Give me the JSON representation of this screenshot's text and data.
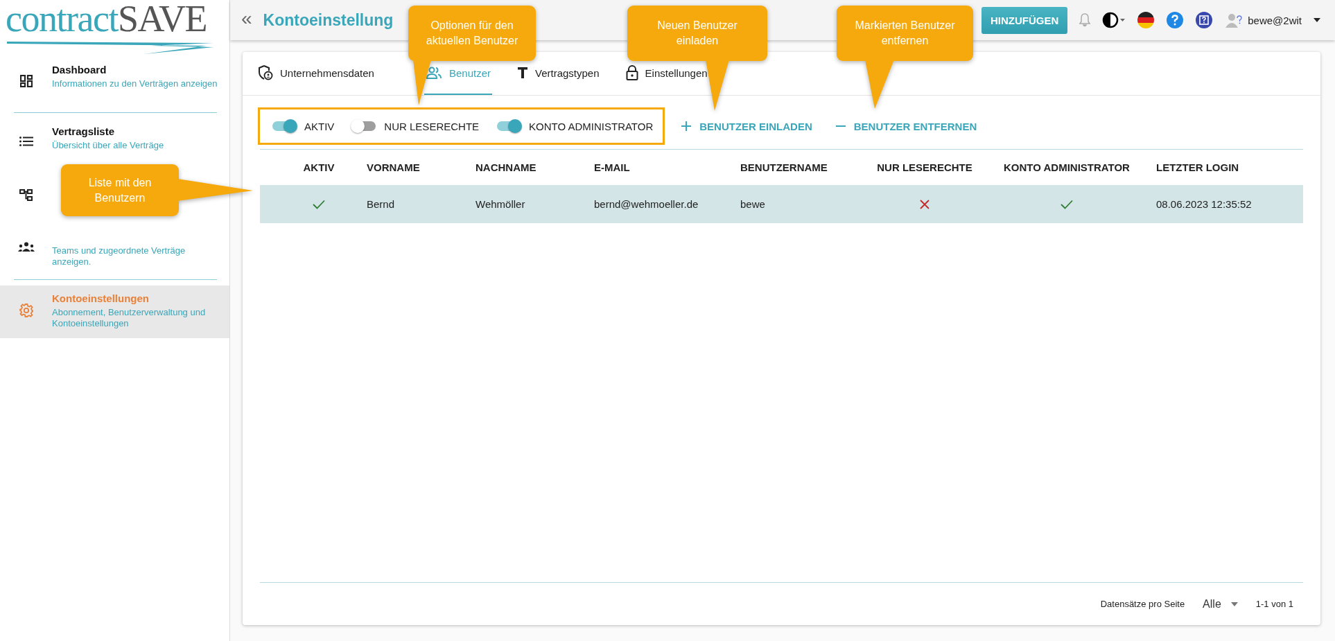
{
  "logo": {
    "left": "contract",
    "right": "SAVE"
  },
  "sidebar": {
    "items": [
      {
        "kind": "dashboard",
        "title": "Dashboard",
        "subtitle": "Informationen zu den Verträgen anzeigen",
        "selected": false,
        "divider": true
      },
      {
        "kind": "list",
        "title": "Vertragsliste",
        "subtitle": "Übersicht über alle Verträge",
        "selected": false,
        "divider": false
      },
      {
        "kind": "hierarchy",
        "selected": false,
        "divider": false
      },
      {
        "kind": "teams",
        "subtitle": "Teams und zugeordnete Verträge anzeigen.",
        "selected": false,
        "divider": true
      },
      {
        "kind": "gear",
        "title": "Kontoeinstellungen",
        "subtitle": "Abonnement, Benutzerverwaltung und Kontoeinstellungen",
        "selected": true,
        "divider": false
      }
    ]
  },
  "topbar": {
    "collapse": "«",
    "title": "Kontoeinstellung",
    "button": "HINZUFÜGEN",
    "user": "bewe@2wit"
  },
  "tabs": [
    {
      "kind": "company",
      "label": "Unternehmensdaten",
      "selected": false
    },
    {
      "kind": "users",
      "label": "Benutzer",
      "selected": true
    },
    {
      "kind": "text",
      "label": "Vertragstypen",
      "selected": false
    },
    {
      "kind": "lock",
      "label": "Einstellungen",
      "selected": false
    }
  ],
  "toggles": [
    {
      "label": "AKTIV",
      "on": true
    },
    {
      "label": "NUR LESERECHTE",
      "on": false
    },
    {
      "label": "KONTO ADMINISTRATOR",
      "on": true
    }
  ],
  "actions": [
    {
      "kind": "add",
      "label": "BENUTZER EINLADEN"
    },
    {
      "kind": "remove",
      "label": "BENUTZER ENTFERNEN"
    }
  ],
  "table": {
    "columns": [
      "AKTIV",
      "VORNAME",
      "NACHNAME",
      "E-MAIL",
      "BENUTZERNAME",
      "NUR LESERECHTE",
      "KONTO ADMINISTRATOR",
      "LETZTER LOGIN"
    ],
    "rows": [
      {
        "aktiv": true,
        "vorname": "Bernd",
        "nachname": "Wehmöller",
        "email": "bernd@wehmoeller.de",
        "benutzername": "bewe",
        "nur_leserechte": false,
        "konto_administrator": true,
        "letzter_login": "08.06.2023 12:35:52",
        "selected": true
      }
    ]
  },
  "footer": {
    "rows_per_page_label": "Datensätze pro Seite",
    "rows_per_page": "Alle",
    "range": "1-1 von 1"
  },
  "callouts": [
    {
      "text": "Optionen für den aktuellen Benutzer"
    },
    {
      "text": "Neuen Benutzer einladen"
    },
    {
      "text": "Markierten Benutzer entfernen"
    },
    {
      "text": "Liste mit den Benutzern"
    }
  ]
}
